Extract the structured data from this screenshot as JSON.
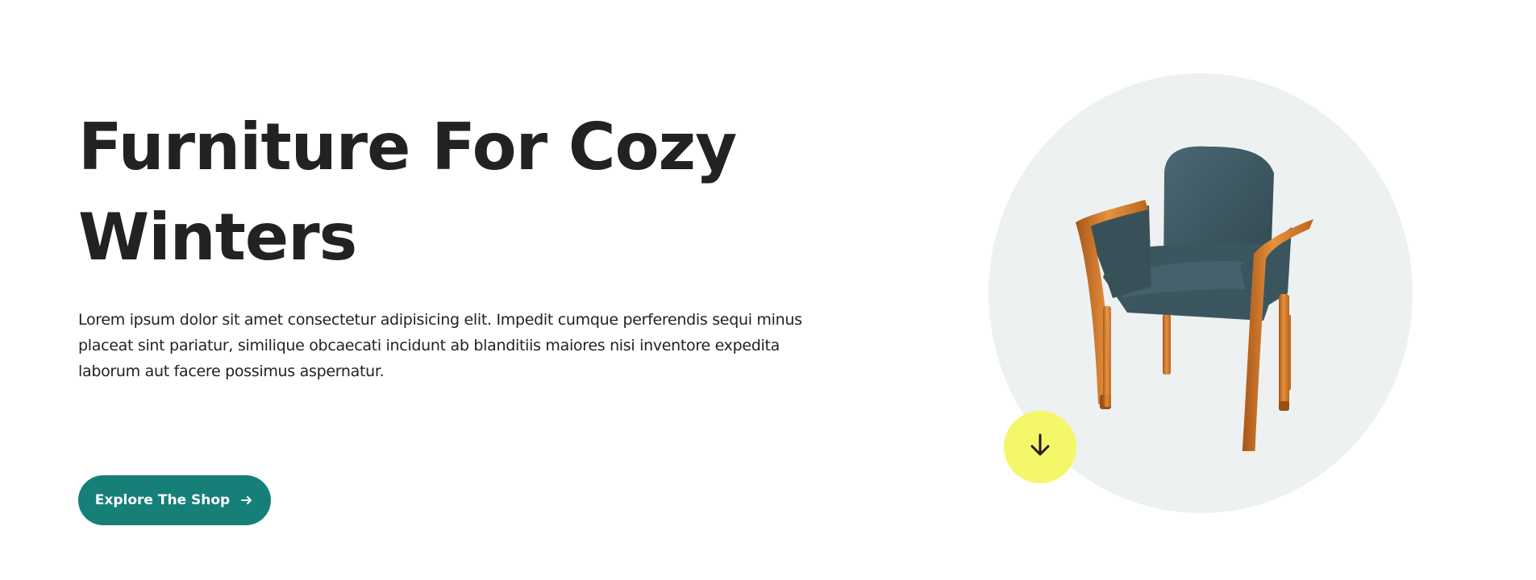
{
  "hero": {
    "title_line1": "Furniture For Cozy",
    "title_line2": "Winters",
    "description": "Lorem ipsum dolor sit amet consectetur adipisicing elit. Impedit cumque perferendis sequi minus placeat sint pariatur, similique obcaecati incidunt ab blanditiis maiores nisi inventore expedita laborum aut facere possimus aspernatur.",
    "cta_label": "Explore The Shop",
    "cta_icon": "arrow-right-icon",
    "scroll_icon": "arrow-down-icon",
    "product_image": "armchair"
  },
  "colors": {
    "accent": "#167f78",
    "scroll_button": "#f5f76a",
    "circle_background": "#eef1f1",
    "text": "#222222",
    "chair_upholstery": "#3f5862",
    "chair_wood": "#c86f24"
  }
}
